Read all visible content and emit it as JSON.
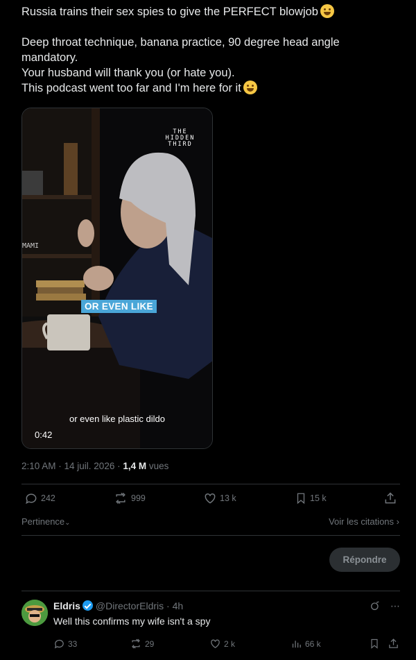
{
  "tweet": {
    "line1": "Russia trains their sex spies to give the PERFECT blowjob",
    "line2": "Deep throat technique, banana practice, 90 degree head angle mandatory.",
    "line3": "Your husband will thank you (or hate you).",
    "line4": "This podcast went too far and I'm here for it"
  },
  "media": {
    "logo_line1": "THE",
    "logo_line2": "HIDDEN",
    "logo_line3": "THIRD",
    "badge_text": "OR EVEN LIKE",
    "subtitle": "or even like plastic dildo",
    "duration": "0:42",
    "shelf_text": "MAMI"
  },
  "meta": {
    "time": "2:10 AM · 14 juil. 2026 · ",
    "views_count": "1,4 M",
    "views_label": " vues"
  },
  "actions": {
    "replies": "242",
    "reposts": "999",
    "likes": "13 k",
    "bookmarks": "15 k"
  },
  "sort": {
    "label": "Pertinence",
    "citations": "Voir les citations"
  },
  "reply_button": "Répondre",
  "reply": {
    "name": "Eldris",
    "handle": "@DirectorEldris · 4h",
    "text": "Well this confirms my wife isn't a spy",
    "replies": "33",
    "reposts": "29",
    "likes": "2 k",
    "views": "66 k"
  },
  "colors": {
    "background": "#000000",
    "text": "#e7e9ea",
    "muted": "#71767b",
    "accent": "#1d9bf0",
    "badge": "#4aa6d8"
  }
}
